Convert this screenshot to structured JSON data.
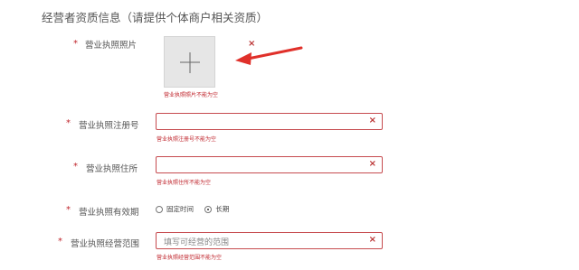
{
  "section": {
    "title": "经营者资质信息（请提供个体商户相关资质）"
  },
  "license_photo": {
    "required_mark": "*",
    "label": "营业执照照片",
    "plus_icon": "plus-icon",
    "error": "营业执照照片不能为空",
    "close_icon": "×"
  },
  "reg_number": {
    "required_mark": "*",
    "label": "营业执照注册号",
    "value": "",
    "clear_icon": "×",
    "error": "营业执照注册号不能为空"
  },
  "address": {
    "required_mark": "*",
    "label": "营业执照住所",
    "value": "",
    "clear_icon": "×",
    "error": "营业执照住所不能为空"
  },
  "validity": {
    "required_mark": "*",
    "label": "营业执照有效期",
    "options": [
      {
        "label": "固定时间",
        "checked": false
      },
      {
        "label": "长期",
        "checked": true
      }
    ]
  },
  "scope": {
    "required_mark": "*",
    "label": "营业执照经营范围",
    "placeholder": "填写可经营的范围",
    "clear_icon": "×",
    "error": "营业执照经营范围不能为空"
  },
  "colors": {
    "error": "#c0262d",
    "arrow": "#e0302a"
  }
}
